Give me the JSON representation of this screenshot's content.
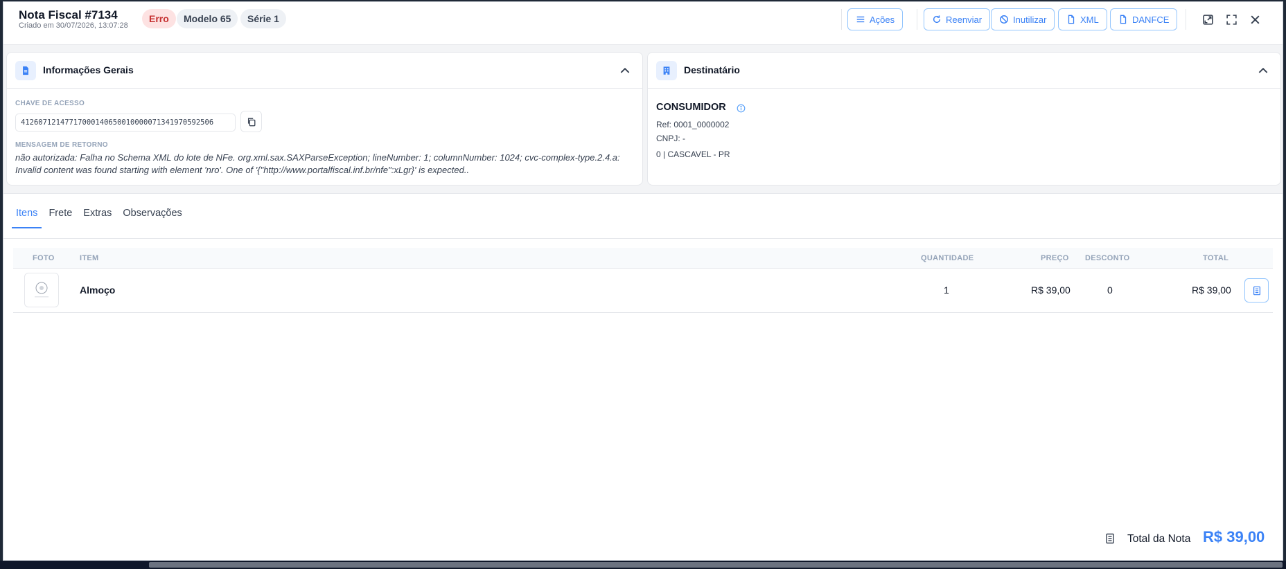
{
  "header": {
    "title": "Nota Fiscal #7134",
    "created": "Criado em 30/07/2026, 13:07:28",
    "badges": {
      "status": "Erro",
      "modelo": "Modelo 65",
      "serie": "Série 1"
    },
    "buttons": {
      "acoes": "Ações",
      "reenviar": "Reenviar",
      "inutilizar": "Inutilizar",
      "xml": "XML",
      "danfce": "DANFCE"
    },
    "icons": [
      "open-external-icon",
      "fullscreen-icon",
      "close-icon"
    ]
  },
  "info_card": {
    "title": "Informações Gerais",
    "chave_label": "CHAVE DE ACESSO",
    "chave_value": "41260712147717000140650010000071341970592506",
    "mensagem_label": "MENSAGEM DE RETORNO",
    "mensagem_value": "não autorizada: Falha no Schema XML do lote de NFe. org.xml.sax.SAXParseException; lineNumber: 1; columnNumber: 1024; cvc-complex-type.2.4.a: Invalid content was found starting with element 'nro'. One of '{\"http://www.portalfiscal.inf.br/nfe\":xLgr}' is expected.."
  },
  "dest_card": {
    "title": "Destinatário",
    "name": "CONSUMIDOR",
    "ref": "Ref: 0001_0000002",
    "cnpj": "CNPJ: -",
    "address": "0 | CASCAVEL - PR"
  },
  "tabs": [
    "Itens",
    "Frete",
    "Extras",
    "Observações"
  ],
  "active_tab": "Itens",
  "table": {
    "columns": {
      "foto": "FOTO",
      "item": "ITEM",
      "quantidade": "QUANTIDADE",
      "preco": "PREÇO",
      "desconto": "DESCONTO",
      "total": "TOTAL"
    },
    "rows": [
      {
        "item": "Almoço",
        "quantidade": "1",
        "preco": "R$ 39,00",
        "desconto": "0",
        "total": "R$ 39,00"
      }
    ]
  },
  "footer": {
    "total_label": "Total da Nota",
    "total_value": "R$ 39,00"
  },
  "colors": {
    "accent": "#3b82f6",
    "error_bg": "#fde2e2",
    "error_text": "#c53030"
  }
}
